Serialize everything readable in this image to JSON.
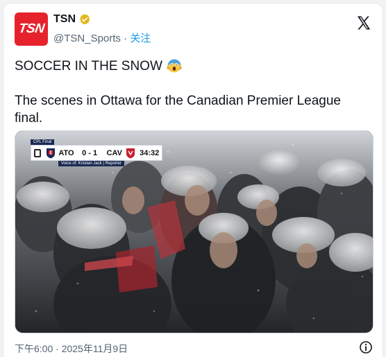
{
  "author": {
    "name": "TSN",
    "avatar_text": "TSN",
    "handle": "@TSN_Sports",
    "separator": "·",
    "follow_label": "关注",
    "verified_icon": "gold-verified-badge"
  },
  "tweet": {
    "line1": "SOCCER IN THE SNOW",
    "emoji": "😱",
    "line2": "The scenes in Ottawa for the Canadian Premier League final."
  },
  "scorebug": {
    "label": "CPL Final",
    "home": "ATO",
    "score": "0 - 1",
    "away": "CAV",
    "clock": "34:32",
    "voice": "Voice of: Kristian Jack | Reporter"
  },
  "footer": {
    "time": "下午6:00",
    "separator": "·",
    "date": "2025年11月9日"
  },
  "colors": {
    "brand_red": "#e6232d",
    "link_blue": "#1d9bf0",
    "text": "#0f1419",
    "muted": "#536471",
    "scorebug_navy": "#1a2a52"
  }
}
